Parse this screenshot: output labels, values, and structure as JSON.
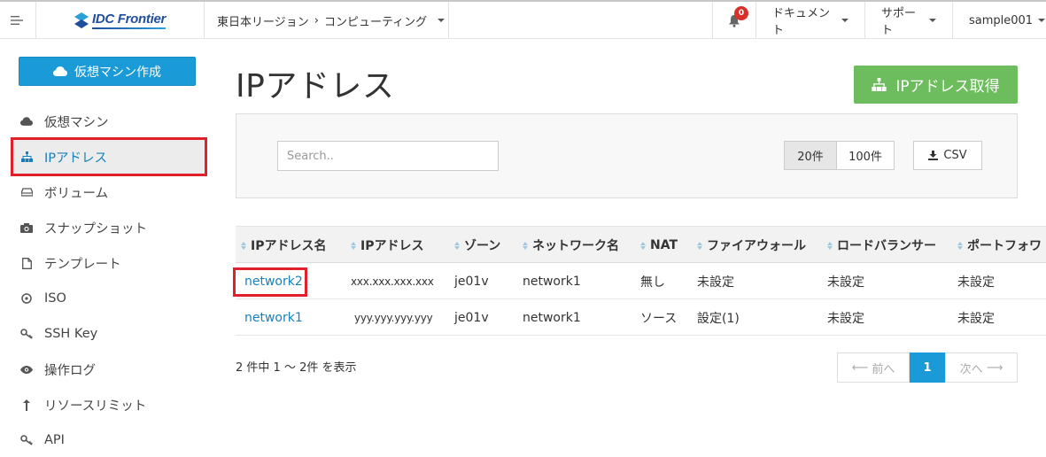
{
  "header": {
    "logo_text": "IDC Frontier",
    "region": "東日本リージョン",
    "separator": "›",
    "service": "コンピューティング",
    "notification_count": "0",
    "documents": "ドキュメント",
    "support": "サポート",
    "user": "sample001"
  },
  "sidebar": {
    "create_button": "仮想マシン作成",
    "items": [
      {
        "label": "仮想マシン",
        "icon": "cloud-icon"
      },
      {
        "label": "IPアドレス",
        "icon": "sitemap-icon",
        "active": true
      },
      {
        "label": "ボリューム",
        "icon": "drive-icon"
      },
      {
        "label": "スナップショット",
        "icon": "camera-icon"
      },
      {
        "label": "テンプレート",
        "icon": "file-icon"
      },
      {
        "label": "ISO",
        "icon": "disc-icon"
      },
      {
        "label": "SSH Key",
        "icon": "key-icon"
      },
      {
        "label": "操作ログ",
        "icon": "eye-icon"
      },
      {
        "label": "リソースリミット",
        "icon": "limit-icon"
      },
      {
        "label": "API",
        "icon": "key-icon"
      }
    ]
  },
  "main": {
    "title": "IPアドレス",
    "get_ip_button": "IPアドレス取得",
    "search_placeholder": "Search..",
    "page_size_20": "20件",
    "page_size_100": "100件",
    "csv_label": "CSV"
  },
  "table": {
    "columns": [
      "IPアドレス名",
      "IPアドレス",
      "ゾーン",
      "ネットワーク名",
      "NAT",
      "ファイアウォール",
      "ロードバランサー",
      "ポートフォワ"
    ],
    "rows": [
      [
        "network2",
        "xxx.xxx.xxx.xxx",
        "je01v",
        "network1",
        "無し",
        "未設定",
        "未設定",
        "未設定"
      ],
      [
        "network1",
        "yyy.yyy.yyy.yyy",
        "je01v",
        "network1",
        "ソース",
        "設定(1)",
        "未設定",
        "未設定"
      ]
    ]
  },
  "pagination": {
    "summary": "2 件中 1 〜 2件 を表示",
    "prev": "前へ",
    "current": "1",
    "next": "次へ"
  },
  "colors": {
    "primary": "#1a9bd7",
    "success": "#6dbd5e",
    "highlight": "#e0202b",
    "link": "#1a7fb8"
  }
}
